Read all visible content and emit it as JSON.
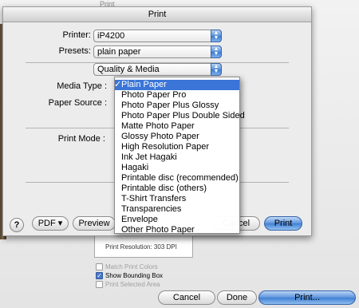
{
  "background": {
    "window_title": "Print",
    "print_resolution": "Print Resolution: 303 DPI",
    "checkboxes": [
      {
        "label": "Match Print Colors",
        "checked": false,
        "enabled": false
      },
      {
        "label": "Show Bounding Box",
        "checked": true,
        "enabled": true
      },
      {
        "label": "Print Selected Area",
        "checked": false,
        "enabled": false
      }
    ],
    "buttons": {
      "cancel": "Cancel",
      "done": "Done",
      "print": "Print..."
    }
  },
  "sheet": {
    "title": "Print",
    "printer_label": "Printer:",
    "printer_value": "iP4200",
    "presets_label": "Presets:",
    "presets_value": "plain paper",
    "panel_value": "Quality & Media",
    "media_type_label": "Media Type :",
    "paper_source_label": "Paper Source :",
    "print_mode_label": "Print Mode :",
    "help_label": "?",
    "pdf_label": "PDF ▾",
    "preview_label": "Preview",
    "cancel_label": "Cancel",
    "print_label": "Print"
  },
  "media_menu": {
    "selected_index": 0,
    "check_mark": "✓",
    "items": [
      "Plain Paper",
      "Photo Paper Pro",
      "Photo Paper Plus Glossy",
      "Photo Paper Plus Double Sided",
      "Matte Photo Paper",
      "Glossy Photo Paper",
      "High Resolution Paper",
      "Ink Jet Hagaki",
      "Hagaki",
      "Printable disc (recommended)",
      "Printable disc (others)",
      "T-Shirt Transfers",
      "Transparencies",
      "Envelope",
      "Other Photo Paper"
    ]
  },
  "colors": {
    "accent": "#3a75d7",
    "menu_highlight": "#3a75d7"
  }
}
